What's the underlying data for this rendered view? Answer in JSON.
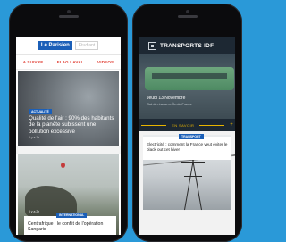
{
  "phone_left": {
    "header": {
      "logo": "Le Parisien",
      "logo_sub": "Etudiant"
    },
    "nav": [
      "A SUIVRE",
      "FLAG LAVAL",
      "VIDEOS"
    ],
    "story1": {
      "tag": "ACTUALITÉ",
      "headline": "Qualité de l'air : 90% des habitants de la planète subissent une pollution excessive",
      "meta": "Il y a 1h"
    },
    "story2": {
      "meta": "Il y a 2h",
      "tag": "INTERNATIONAL",
      "title": "Centrafrique : le conflit de l'opération Sangaris"
    }
  },
  "phone_right": {
    "header": {
      "brand": "TRANSPORTS IDF"
    },
    "hero": {
      "title": "Jeudi 13 Novembre",
      "subtitle": "Etat du réseau en Île-de-France"
    },
    "more": {
      "label": "EN SAVOIR",
      "plus": "+"
    },
    "story": {
      "tag": "TRANSPORT",
      "title": "Electricité : comment la France veut éviter le black out cet hiver"
    }
  }
}
